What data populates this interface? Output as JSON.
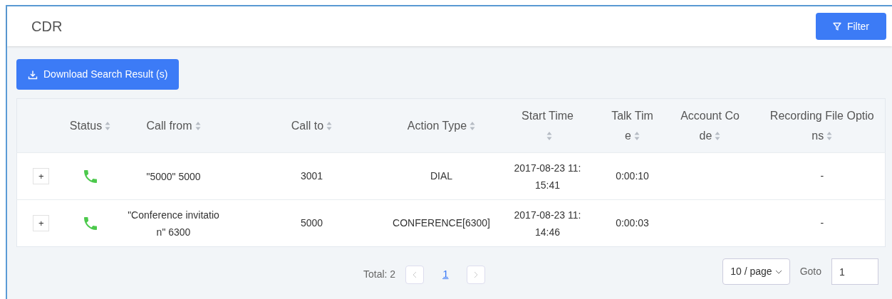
{
  "page_title": "CDR",
  "filter_button": "Filter",
  "download_button": "Download Search Result (s)",
  "columns": [
    {
      "sortable": false
    },
    {
      "label": "Status",
      "sortable": true
    },
    {
      "label": "Call from",
      "sortable": true
    },
    {
      "label": "Call to",
      "sortable": true
    },
    {
      "label": "Action Type",
      "sortable": true
    },
    {
      "label": "Start Time",
      "sortable": true
    },
    {
      "label": "Talk Time",
      "sortable": true
    },
    {
      "label": "Account Code",
      "sortable": true
    },
    {
      "label": "Recording File Options",
      "sortable": true
    }
  ],
  "rows": [
    {
      "expand": "+",
      "call_from": "\"5000\" 5000",
      "call_to": "3001",
      "action_type": "DIAL",
      "start_time": "2017-08-23 11:15:41",
      "talk_time": "0:00:10",
      "recording": "-"
    },
    {
      "expand": "+",
      "call_from": "\"Conference invitation\" 6300",
      "call_to": "5000",
      "action_type": "CONFERENCE[6300]",
      "start_time": "2017-08-23 11:14:46",
      "talk_time": "0:00:03",
      "recording": "-"
    }
  ],
  "pagination": {
    "total": "Total: 2",
    "pages": [
      {
        "label": "1",
        "selected": true
      }
    ],
    "page_size": "10 / page",
    "goto_label": "Goto",
    "goto_value": "1"
  }
}
